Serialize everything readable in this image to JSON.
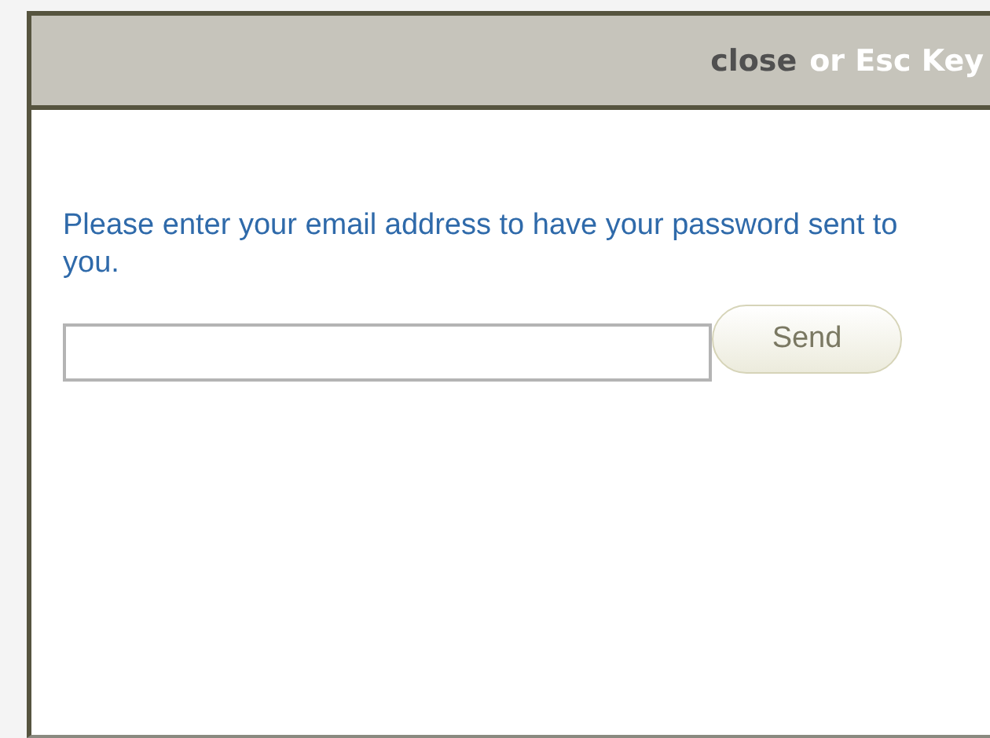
{
  "header": {
    "close_link": "close",
    "hint": "or Esc Key"
  },
  "message": "Please enter your email address to have your password sent to you.",
  "buttons": [
    "Send"
  ]
}
